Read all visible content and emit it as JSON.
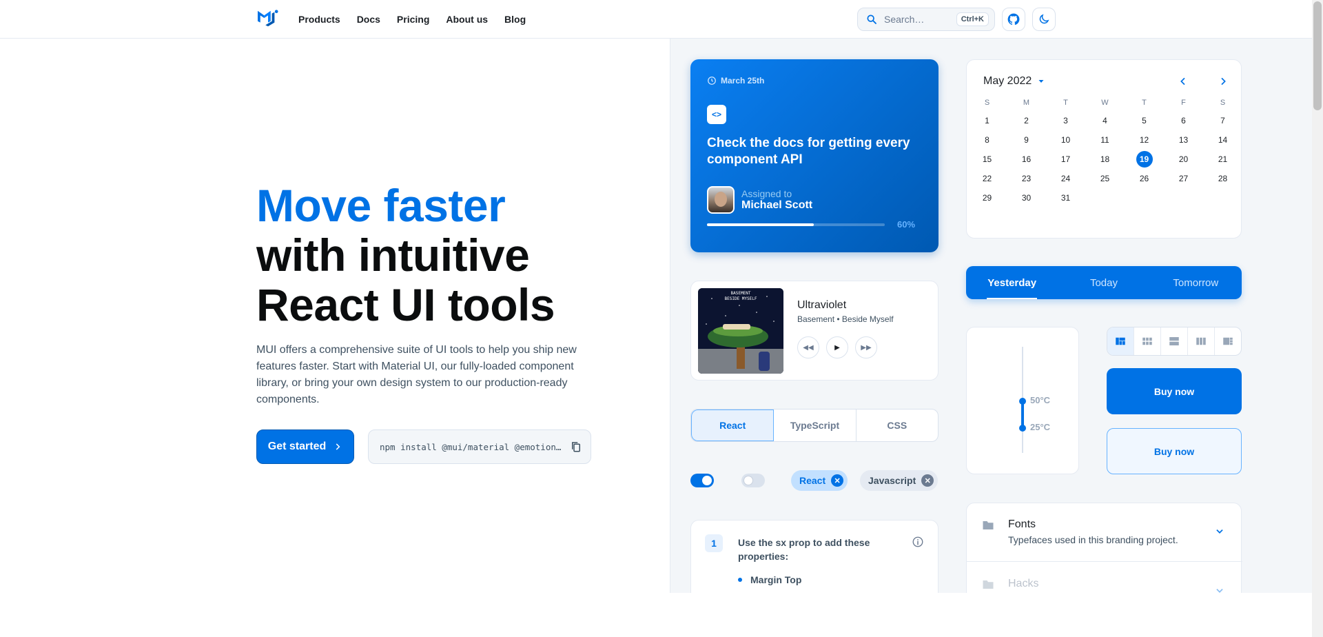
{
  "nav": {
    "items": [
      "Products",
      "Docs",
      "Pricing",
      "About us",
      "Blog"
    ],
    "search_placeholder": "Search…",
    "search_shortcut": "Ctrl+K",
    "github_icon": "github-icon",
    "theme_icon": "moon-icon"
  },
  "hero": {
    "title_blue": "Move faster",
    "title_line2": "with intuitive",
    "title_line3": "React UI tools",
    "description": "MUI offers a comprehensive suite of UI tools to help you ship new features faster. Start with Material UI, our fully-loaded component library, or bring your own design system to our production-ready components.",
    "cta_label": "Get started",
    "install_command": "npm install @mui/material @emotion…"
  },
  "task_card": {
    "date": "March 25th",
    "title": "Check the docs for getting every component API",
    "assigned_label": "Assigned to",
    "assignee": "Michael Scott",
    "progress_text": "60%",
    "progress_value": 0.6
  },
  "calendar": {
    "month_label": "May 2022",
    "weekdays": [
      "S",
      "M",
      "T",
      "W",
      "T",
      "F",
      "S"
    ],
    "start_offset": 0,
    "days_in_month": 31,
    "selected_day": 19
  },
  "day_tabs": {
    "items": [
      "Yesterday",
      "Today",
      "Tomorrow"
    ],
    "active": 0
  },
  "player": {
    "track": "Ultraviolet",
    "artist_album": "Basement • Beside Myself",
    "album_text": "BASEMENT\nBESIDE MYSELF"
  },
  "lang_tabs": {
    "items": [
      "React",
      "TypeScript",
      "CSS"
    ],
    "active": 0
  },
  "chips": [
    {
      "label": "React",
      "color": "#0072e5"
    },
    {
      "label": "Javascript",
      "color": "#3e5060"
    }
  ],
  "slider": {
    "upper_label": "50°C",
    "lower_label": "25°C"
  },
  "buttons": {
    "buy_primary": "Buy now",
    "buy_outlined": "Buy now"
  },
  "sx_card": {
    "step": "1",
    "text": "Use the sx prop to add these properties:",
    "items": [
      "Margin Top"
    ]
  },
  "accordion": {
    "items": [
      {
        "title": "Fonts",
        "subtitle": "Typefaces used in this branding project."
      },
      {
        "title": "Hacks",
        "subtitle": ""
      }
    ]
  },
  "colors": {
    "primary": "#0072e5",
    "dark_text": "#0b0d0e",
    "panel_bg": "#f3f6f9"
  }
}
